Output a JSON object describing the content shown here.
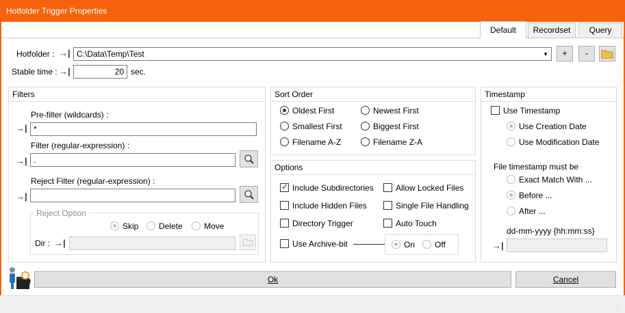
{
  "window": {
    "title": "Hotfolder Trigger Properties"
  },
  "tabs": [
    {
      "label": "Default",
      "active": true
    },
    {
      "label": "Recordset",
      "active": false
    },
    {
      "label": "Query",
      "active": false
    }
  ],
  "hotfolder": {
    "label": "Hotfolder :",
    "value": "C:\\Data\\Temp\\Test",
    "add": "+",
    "remove": "-"
  },
  "stable": {
    "label": "Stable time :",
    "value": "20",
    "unit": "sec."
  },
  "filters": {
    "title": "Filters",
    "prefilter_label": "Pre-filter (wildcards) :",
    "prefilter_value": "*",
    "filter_label": "Filter (regular-expression) :",
    "filter_value": ".",
    "reject_label": "Reject Filter (regular-expression) :",
    "reject_value": "",
    "reject_option": {
      "title": "Reject Option",
      "options": [
        "Skip",
        "Delete",
        "Move"
      ],
      "selected": "Skip",
      "dir_label": "Dir :",
      "dir_value": ""
    }
  },
  "sort_order": {
    "title": "Sort Order",
    "options": [
      "Oldest First",
      "Newest First",
      "Smallest First",
      "Biggest First",
      "Filename A-Z",
      "Filename Z-A"
    ],
    "selected": "Oldest First"
  },
  "options": {
    "title": "Options",
    "include_subdirectories": {
      "label": "Include Subdirectories",
      "checked": true
    },
    "allow_locked_files": {
      "label": "Allow Locked Files",
      "checked": false
    },
    "include_hidden_files": {
      "label": "Include Hidden Files",
      "checked": false
    },
    "single_file_handling": {
      "label": "Single File Handling",
      "checked": false
    },
    "directory_trigger": {
      "label": "Directory Trigger",
      "checked": false
    },
    "auto_touch": {
      "label": "Auto Touch",
      "checked": false
    },
    "use_archive_bit": {
      "label": "Use Archive-bit",
      "checked": false
    },
    "archive_on": "On",
    "archive_off": "Off",
    "archive_selected": "On"
  },
  "timestamp": {
    "title": "Timestamp",
    "use_timestamp": {
      "label": "Use Timestamp",
      "checked": false
    },
    "use_creation_date": "Use Creation Date",
    "use_modification_date": "Use Modification Date",
    "date_selected": "Use Creation Date",
    "must_be_label": "File timestamp must be",
    "exact_match": "Exact Match With ...",
    "before": "Before ...",
    "after": "After ...",
    "comparison_selected": "Before ...",
    "format_label": "dd-mm-yyyy {hh:mm:ss}",
    "format_value": ""
  },
  "buttons": {
    "ok": "Ok",
    "cancel": "Cancel"
  },
  "colors": {
    "titlebar": "#f7630c",
    "border": "#dcdcdc"
  }
}
